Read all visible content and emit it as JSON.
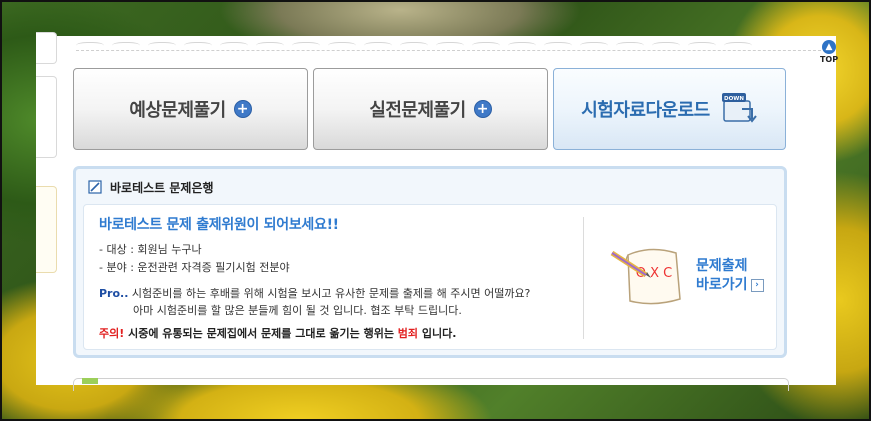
{
  "tabs": [
    {
      "label": "예상문제풀기",
      "icon": "plus-circle-icon"
    },
    {
      "label": "실전문제풀기",
      "icon": "plus-circle-icon"
    },
    {
      "label": "시험자료다운로드",
      "icon": "download-folder-icon",
      "icon_text": "DOWN"
    }
  ],
  "bank": {
    "title": "바로테스트 문제은행",
    "headline": "바로테스트 문제 출제위원이 되어보세요!!",
    "target_line": "- 대상 : 회원님 누구나",
    "field_line": "- 분야 : 운전관련 자격증 필기시험 전분야",
    "pro_tag": "Pro..",
    "pro_line1": " 시험준비를 하는 후배를 위해 시험을 보시고 유사한 문제를 출제를 해 주시면 어떨까요?",
    "pro_line2": "아마 시험준비를 할 많은 분들께 힘이 될 것 입니다. 협조 부탁 드립니다.",
    "warn_tag": "주의!",
    "warn_text": " 시중에 유통되는 문제집에서 문제를 그대로 옮기는 행위는 ",
    "warn_crime": "범죄",
    "warn_end": " 입니다.",
    "shortcut_line1": "문제출제",
    "shortcut_line2": "바로가기",
    "shortcut_arrow": "›",
    "paper_marks": "O X C"
  },
  "top_button": {
    "label": "TOP",
    "arrow": "▲"
  },
  "colors": {
    "accent_blue": "#2f7bd0",
    "warning_red": "#e21f1f",
    "frame_blue": "#c9ddf0"
  }
}
